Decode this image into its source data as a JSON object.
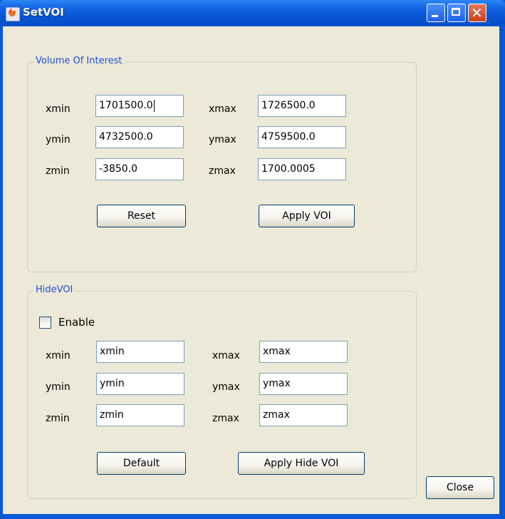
{
  "window": {
    "title": "SetVOI"
  },
  "voi": {
    "title": "Volume Of Interest",
    "labels": {
      "xmin": "xmin",
      "xmax": "xmax",
      "ymin": "ymin",
      "ymax": "ymax",
      "zmin": "zmin",
      "zmax": "zmax"
    },
    "values": {
      "xmin": "1701500.0",
      "xmax": "1726500.0",
      "ymin": "4732500.0",
      "ymax": "4759500.0",
      "zmin": "-3850.0",
      "zmax": "1700.0005"
    },
    "reset_label": "Reset",
    "apply_label": "Apply VOI"
  },
  "hide": {
    "title": "HideVOI",
    "enable_label": "Enable",
    "enabled": false,
    "labels": {
      "xmin": "xmin",
      "xmax": "xmax",
      "ymin": "ymin",
      "ymax": "ymax",
      "zmin": "zmin",
      "zmax": "zmax"
    },
    "values": {
      "xmin": "xmin",
      "xmax": "xmax",
      "ymin": "ymin",
      "ymax": "ymax",
      "zmin": "zmin",
      "zmax": "zmax"
    },
    "default_label": "Default",
    "apply_label": "Apply Hide VOI"
  },
  "close_label": "Close"
}
